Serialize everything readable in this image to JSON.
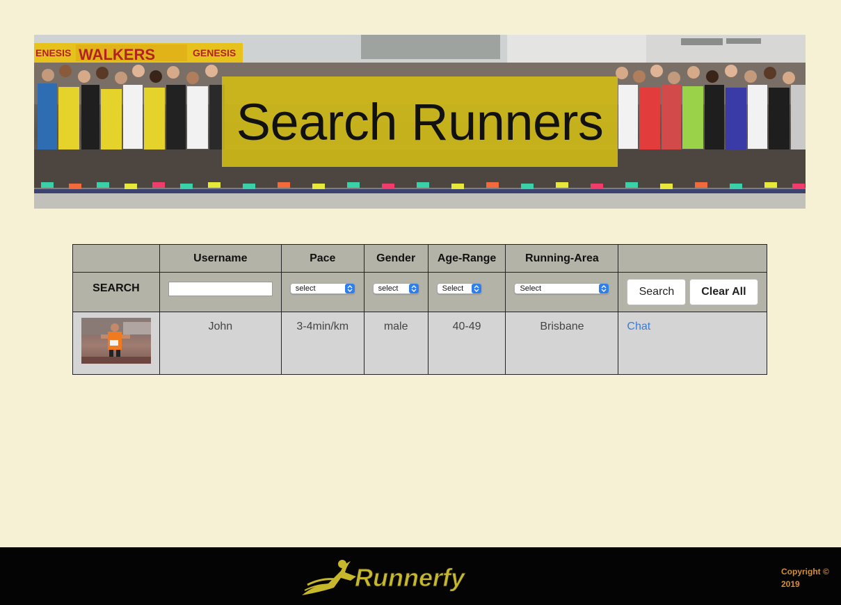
{
  "hero": {
    "title": "Search Runners",
    "banner_sign_left": "ENESIS",
    "banner_sign_main": "WALKERS",
    "banner_sign_right": "GENESIS"
  },
  "table": {
    "headers": [
      "",
      "Username",
      "Pace",
      "Gender",
      "Age-Range",
      "Running-Area",
      ""
    ],
    "search_label": "SEARCH",
    "username_input": {
      "value": "",
      "placeholder": ""
    },
    "selects": {
      "pace": "select",
      "gender": "select",
      "age_range": "Select",
      "running_area": "Select"
    },
    "buttons": {
      "search": "Search",
      "clear_all": "Clear All"
    },
    "results": [
      {
        "username": "John",
        "pace": "3-4min/km",
        "gender": "male",
        "age_range": "40-49",
        "running_area": "Brisbane",
        "action": "Chat"
      }
    ]
  },
  "footer": {
    "logo_text": "Runnerfy",
    "copyright_line1": "Copyright ©",
    "copyright_line2": "2019"
  },
  "colors": {
    "page_bg": "#f6f0d4",
    "title_box": "#d4be14",
    "table_header_bg": "#b3b3a8",
    "result_bg": "#d4d4d4",
    "footer_bg": "#040404",
    "copyright": "#d4903a",
    "link": "#3a7bd5",
    "select_arrow": "#2f7fea"
  },
  "icons": {
    "select_arrow": "up-down-chevron-icon",
    "logo": "running-man-icon"
  }
}
